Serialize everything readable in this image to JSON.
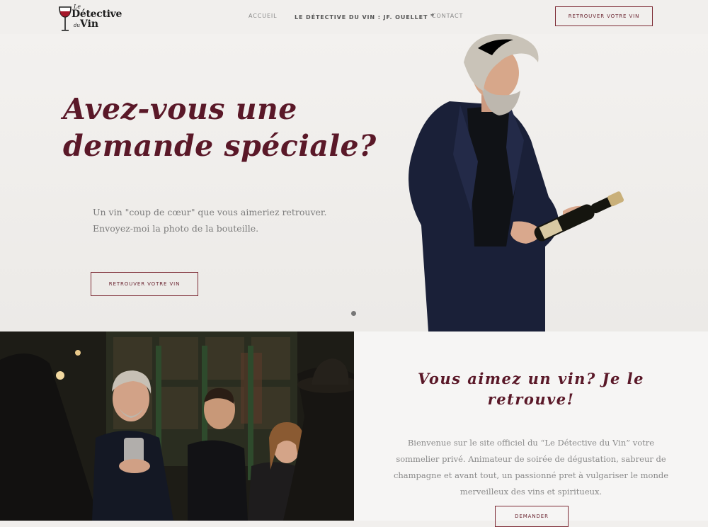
{
  "logo": {
    "le": "Le",
    "main": "Détective",
    "du": "du",
    "vin": "Vin"
  },
  "nav": {
    "items": [
      {
        "label": "ACCUEIL"
      },
      {
        "label": "LE DÉTECTIVE DU VIN : JF. OUELLET",
        "marker": "*"
      },
      {
        "label": "CONTACT"
      }
    ],
    "cta": "RETROUVER VOTRE VIN"
  },
  "hero": {
    "title_line1": "Avez-vous une",
    "title_line2": "demande spéciale?",
    "text_line1": "Un vin \"coup de cœur\" que vous aimeriez retrouver.",
    "text_line2": "Envoyez-moi la photo de la bouteille.",
    "button": "RETROUVER VOTRE VIN"
  },
  "section": {
    "title_line1": "Vous aimez un vin? Je le",
    "title_line2": "retrouve!",
    "text": "Bienvenue sur le site officiel du “Le Détective du Vin” votre sommelier privé. Animateur de soirée de dégustation, sabreur de champagne et avant tout, un passionné pret à vulgariser le monde merveilleux des vins et spiritueux.",
    "button": "DEMANDER"
  },
  "colors": {
    "accent": "#5a1828",
    "border": "#7d2b35",
    "background": "#f1efed"
  }
}
